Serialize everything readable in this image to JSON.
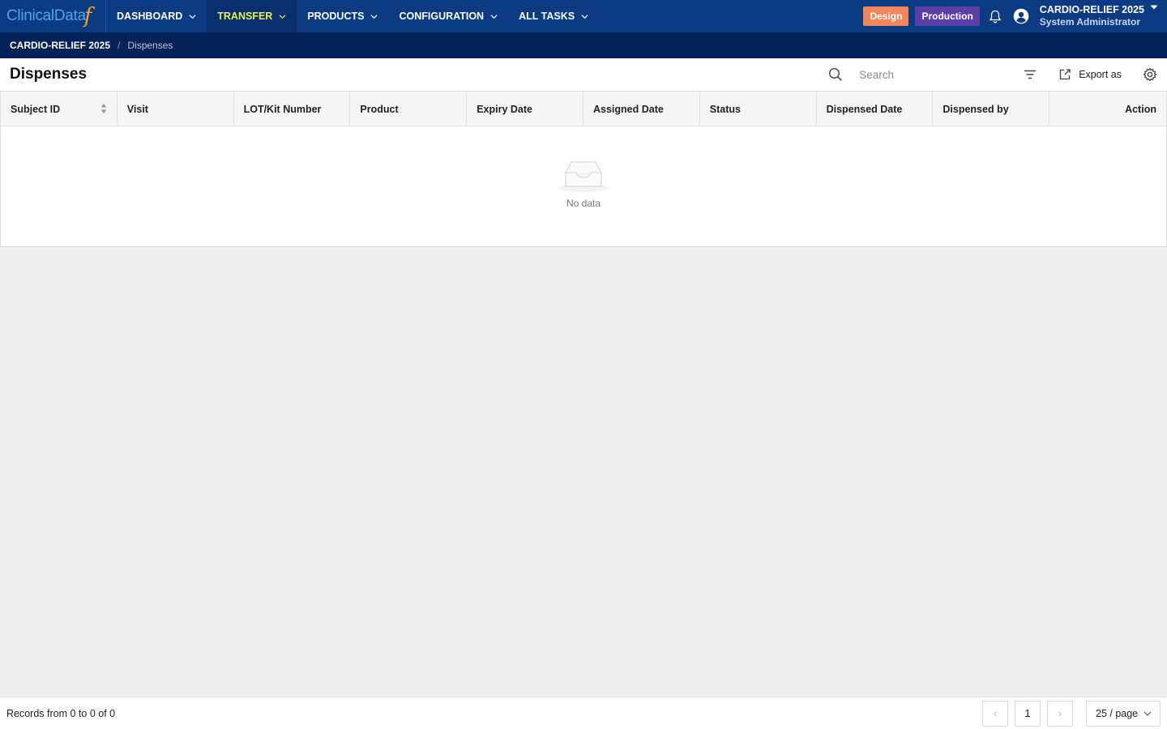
{
  "app": {
    "logo_text": "ClinicalData",
    "logo_mark": "f",
    "nav": [
      {
        "label": "DASHBOARD",
        "active": false
      },
      {
        "label": "TRANSFER",
        "active": true
      },
      {
        "label": "PRODUCTS",
        "active": false
      },
      {
        "label": "CONFIGURATION",
        "active": false
      },
      {
        "label": "ALL TASKS",
        "active": false
      }
    ],
    "env_design": "Design",
    "env_production": "Production",
    "study_name": "CARDIO-RELIEF 2025",
    "user_role": "System Administrator",
    "colors": {
      "nav_bg": "#0d3b82",
      "nav_active_bg": "#0a2f6c",
      "nav_active_text": "#e8f04a",
      "breadcrumb_bg": "#062357",
      "design_badge": "#f2865b",
      "production_badge": "#5b3fa6"
    }
  },
  "breadcrumb": {
    "study": "CARDIO-RELIEF 2025",
    "separator": "/",
    "page": "Dispenses"
  },
  "header": {
    "title": "Dispenses",
    "search_placeholder": "Search",
    "export_label": "Export as",
    "icons": [
      "search-icon",
      "filter-icon",
      "export-icon",
      "settings-icon"
    ]
  },
  "table": {
    "columns": [
      "Subject ID",
      "Visit",
      "LOT/Kit Number",
      "Product",
      "Expiry Date",
      "Assigned Date",
      "Status",
      "Dispensed Date",
      "Dispensed by",
      "Action"
    ],
    "rows": [],
    "empty_text": "No data"
  },
  "footer": {
    "records_text": "Records from 0 to 0 of 0",
    "prev_label": "‹",
    "current_page": "1",
    "next_label": "›",
    "page_size": "25 / page"
  }
}
